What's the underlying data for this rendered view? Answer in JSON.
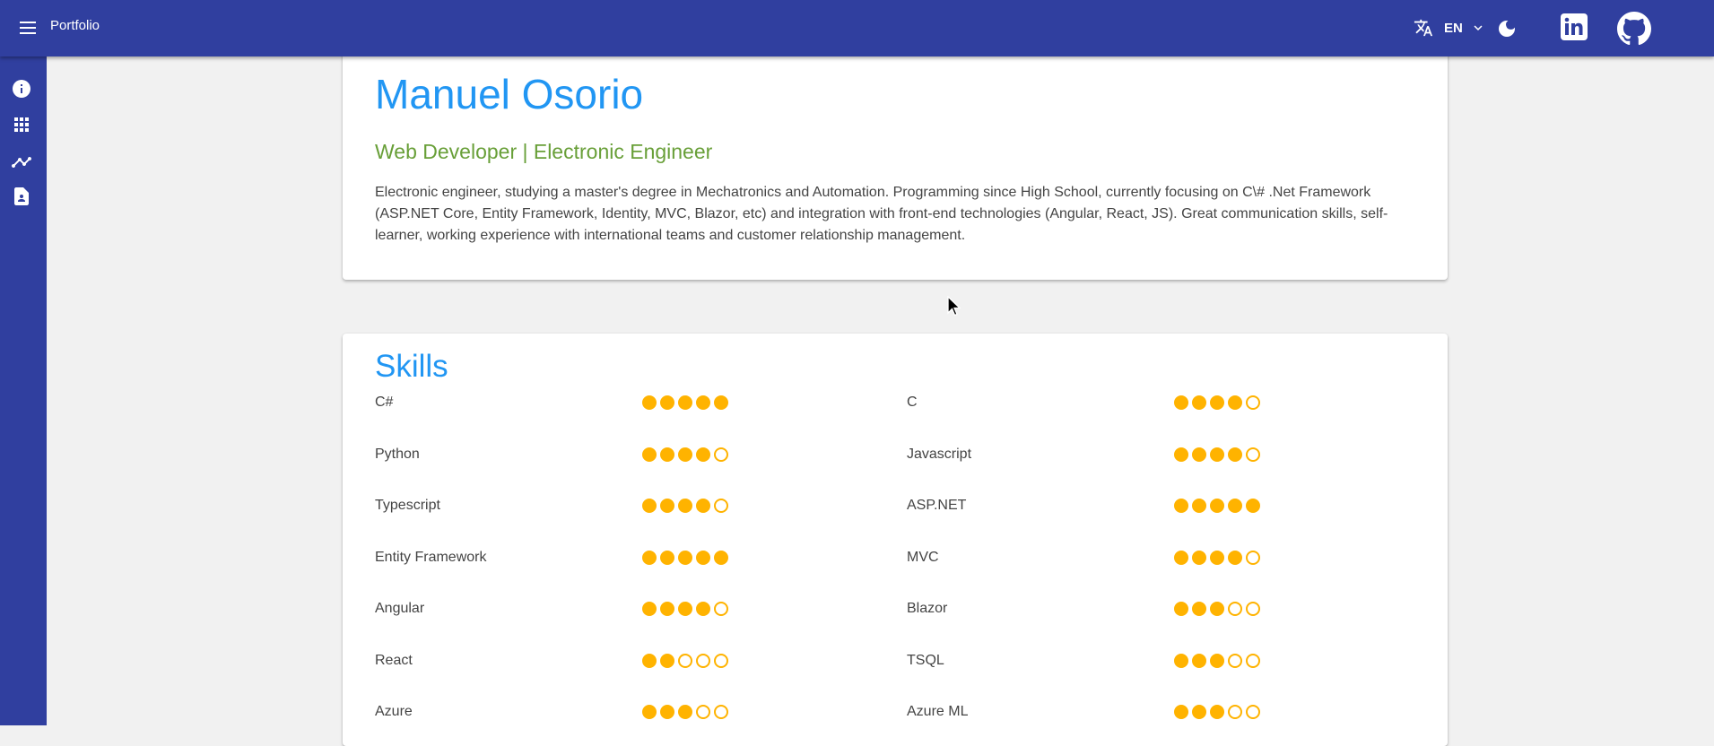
{
  "header": {
    "app_title": "Portfolio",
    "language_code": "EN",
    "icons": [
      "menu-icon",
      "translate-icon",
      "chevron-down-icon",
      "moon-icon",
      "linkedin-icon",
      "github-icon"
    ]
  },
  "sidenav": {
    "items": [
      {
        "name": "info-icon"
      },
      {
        "name": "apps-grid-icon"
      },
      {
        "name": "trending-chart-icon"
      },
      {
        "name": "contact-document-icon"
      }
    ]
  },
  "profile": {
    "name": "Manuel Osorio",
    "subtitle": "Web Developer | Electronic Engineer",
    "bio": "Electronic engineer, studying a master's degree in Mechatronics and Automation. Programming since High School, currently focusing on C\\# .Net Framework (ASP.NET Core, Entity Framework, Identity, MVC, Blazor, etc) and integration with front-end technologies (Angular, React, JS). Great communication skills, self-learner, working experience with international teams and customer relationship management."
  },
  "skills": {
    "heading": "Skills",
    "max_rating": 5,
    "items": [
      {
        "label": "C#",
        "rating": 5
      },
      {
        "label": "C",
        "rating": 4
      },
      {
        "label": "Python",
        "rating": 4
      },
      {
        "label": "Javascript",
        "rating": 4
      },
      {
        "label": "Typescript",
        "rating": 4
      },
      {
        "label": "ASP.NET",
        "rating": 5
      },
      {
        "label": "Entity Framework",
        "rating": 5
      },
      {
        "label": "MVC",
        "rating": 4
      },
      {
        "label": "Angular",
        "rating": 4
      },
      {
        "label": "Blazor",
        "rating": 3
      },
      {
        "label": "React",
        "rating": 2
      },
      {
        "label": "TSQL",
        "rating": 3
      },
      {
        "label": "Azure",
        "rating": 3
      },
      {
        "label": "Azure ML",
        "rating": 3
      }
    ]
  },
  "colors": {
    "primary": "#303f9f",
    "heading_blue": "#2196f3",
    "subtitle_green": "#689f38",
    "rating_amber": "#ffb300"
  }
}
